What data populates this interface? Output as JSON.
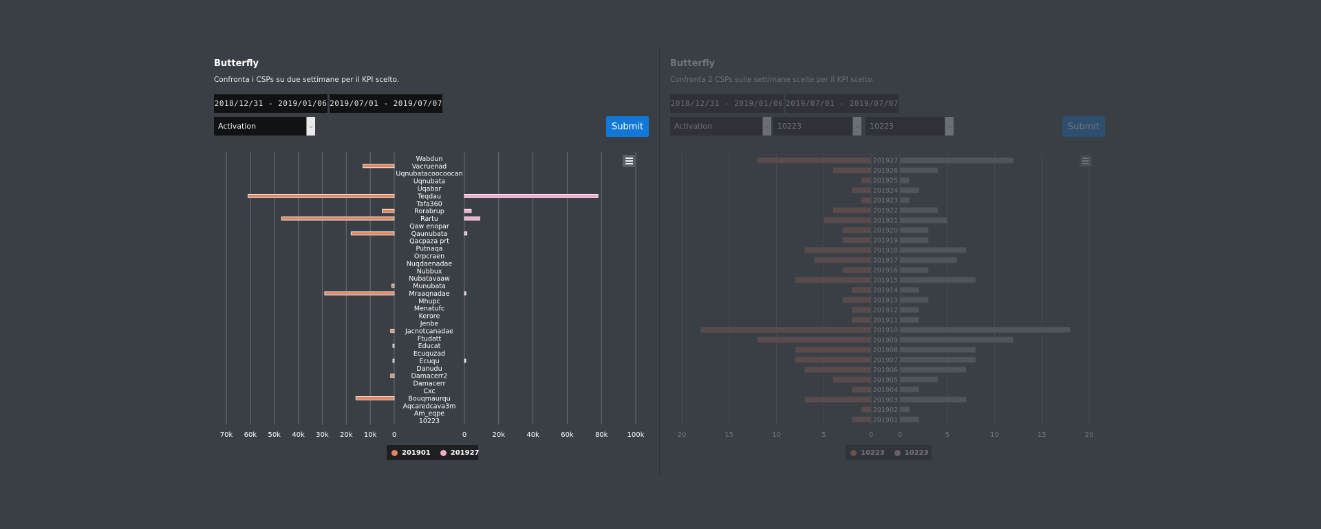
{
  "left": {
    "title": "Butterfly",
    "subtitle": "Confronta i CSPs su due settimane per il KPI scelto.",
    "week1": "2018/12/31 - 2019/01/06",
    "week2": "2019/07/01 - 2019/07/07",
    "kpi": "Activation",
    "submit": "Submit",
    "menu_icon": "hamburger-icon"
  },
  "right": {
    "title": "Butterfly",
    "subtitle": "Confronta 2 CSPs sulle settimane scelte per il KPI scelto.",
    "week1": "2018/12/31 - 2019/01/06",
    "week2": "2019/07/01 - 2019/07/07",
    "kpi": "Activation",
    "csp1": "10223",
    "csp2": "10223",
    "submit": "Submit",
    "menu_icon": "hamburger-icon"
  },
  "colors": {
    "series_left": "#e2865f",
    "series_right": "#f3a9cc",
    "submit": "#1178d8",
    "background": "#3a3e45"
  },
  "chart_data": [
    {
      "type": "bar",
      "orientation": "horizontal-butterfly",
      "categories": [
        "Wabdun",
        "Vacruenad",
        "Uqnubatacoocoocan",
        "Uqnubata",
        "Uqabar",
        "Teqdau",
        "Tafa360",
        "Rorabrup",
        "Rartu",
        "Qaw enopar",
        "Qaunubata",
        "Qacpaza prt",
        "Putnaqa",
        "Orpcraen",
        "Nuqdaenadae",
        "Nubbux",
        "Nubatavaaw",
        "Munubata",
        "Mraaqnadae",
        "Mhupc",
        "Menatufc",
        "Kerore",
        "Jenbe",
        "Jacnotcanadae",
        "Ftudatt",
        "Educat",
        "Ecuquzad",
        "Ecuqu",
        "Danudu",
        "Damacerr2",
        "Damacerr",
        "Cxc",
        "Bouqmaurqu",
        "Aqcaredcava3m",
        "Am_eqpe",
        "10223"
      ],
      "series": [
        {
          "name": "201901",
          "values": [
            0,
            13000,
            0,
            0,
            0,
            61000,
            0,
            5000,
            47000,
            0,
            18000,
            0,
            0,
            0,
            0,
            0,
            0,
            1000,
            29000,
            0,
            0,
            0,
            0,
            1500,
            0,
            200,
            0,
            400,
            0,
            1500,
            0,
            0,
            16000,
            0,
            0,
            0
          ]
        },
        {
          "name": "201927",
          "values": [
            0,
            0,
            0,
            0,
            0,
            78000,
            0,
            4000,
            9000,
            0,
            1500,
            0,
            0,
            0,
            0,
            0,
            0,
            0,
            900,
            0,
            0,
            0,
            0,
            0,
            0,
            0,
            0,
            600,
            0,
            0,
            0,
            0,
            0,
            0,
            0,
            0
          ]
        }
      ],
      "left_axis_ticks": [
        "70k",
        "60k",
        "50k",
        "40k",
        "30k",
        "20k",
        "10k",
        "0"
      ],
      "right_axis_ticks": [
        "0",
        "20k",
        "40k",
        "60k",
        "80k",
        "100k"
      ],
      "left_xlim": [
        0,
        70000
      ],
      "right_xlim": [
        0,
        100000
      ],
      "grid": true,
      "legend_position": "bottom-center"
    },
    {
      "type": "bar",
      "orientation": "horizontal-butterfly",
      "categories": [
        "201927",
        "201926",
        "201925",
        "201924",
        "201923",
        "201922",
        "201921",
        "201920",
        "201919",
        "201918",
        "201917",
        "201916",
        "201915",
        "201914",
        "201913",
        "201912",
        "201911",
        "201910",
        "201909",
        "201908",
        "201907",
        "201906",
        "201905",
        "201904",
        "201903",
        "201902",
        "201901"
      ],
      "series": [
        {
          "name": "10223",
          "values": [
            12,
            4,
            1,
            2,
            1,
            4,
            5,
            3,
            3,
            7,
            6,
            3,
            8,
            2,
            3,
            2,
            2,
            18,
            12,
            8,
            8,
            7,
            4,
            2,
            7,
            1,
            2
          ]
        },
        {
          "name": "10223",
          "values": [
            12,
            4,
            1,
            2,
            1,
            4,
            5,
            3,
            3,
            7,
            6,
            3,
            8,
            2,
            3,
            2,
            2,
            18,
            12,
            8,
            8,
            7,
            4,
            2,
            7,
            1,
            2
          ]
        }
      ],
      "left_axis_ticks": [
        "20",
        "15",
        "10",
        "5",
        "0"
      ],
      "right_axis_ticks": [
        "0",
        "5",
        "10",
        "15",
        "20"
      ],
      "left_xlim": [
        0,
        20
      ],
      "right_xlim": [
        0,
        20
      ],
      "grid": true,
      "legend_position": "bottom-center"
    }
  ]
}
